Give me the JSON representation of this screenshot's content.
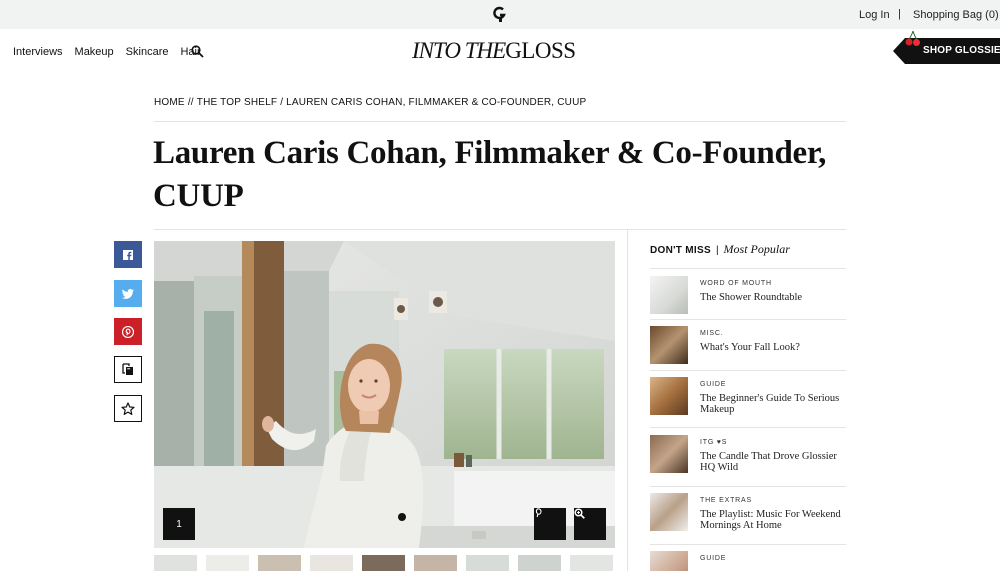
{
  "topbar": {
    "login": "Log In",
    "separator": "|",
    "bag": "Shopping Bag (0)"
  },
  "nav": {
    "items": [
      "Interviews",
      "Makeup",
      "Skincare",
      "Hair"
    ]
  },
  "brand": {
    "part1": "INTO THE",
    "part2": "GLOSS"
  },
  "shop": {
    "label": "SHOP GLOSSIER"
  },
  "breadcrumb": {
    "home": "HOME",
    "sep": "//",
    "section": "THE TOP SHELF",
    "sep2": "/",
    "current": "LAUREN CARIS COHAN, FILMMAKER & CO-FOUNDER, CUUP"
  },
  "article": {
    "title": "Lauren Caris Cohan, Filmmaker & Co-Founder, CUUP"
  },
  "gallery": {
    "counter": "1"
  },
  "sidebar": {
    "dont_miss": "DON'T MISS",
    "bar": "|",
    "most_popular": "Most Popular",
    "items": [
      {
        "category": "WORD OF MOUTH",
        "title": "The Shower Roundtable"
      },
      {
        "category": "MISC.",
        "title": "What's Your Fall Look?"
      },
      {
        "category": "GUIDE",
        "title": "The Beginner's Guide To Serious Makeup"
      },
      {
        "category": "ITG ♥S",
        "title": "The Candle That Drove Glossier HQ Wild"
      },
      {
        "category": "THE EXTRAS",
        "title": "The Playlist: Music For Weekend Mornings At Home"
      },
      {
        "category": "GUIDE",
        "title": ""
      }
    ]
  },
  "colors": {
    "facebook": "#3b5998",
    "twitter": "#55acee",
    "pinterest": "#cb2027"
  }
}
